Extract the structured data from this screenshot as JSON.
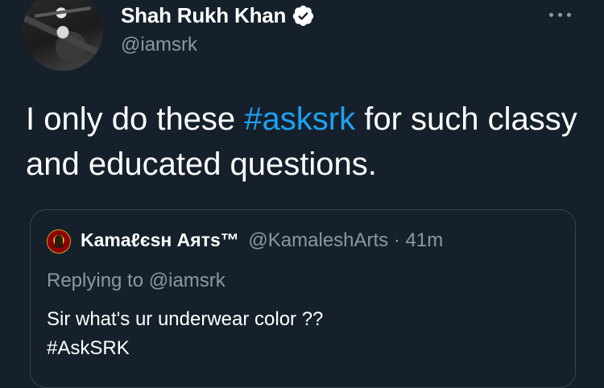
{
  "tweet": {
    "author_name": "Shah Rukh Khan",
    "author_handle": "@iamsrk",
    "text_before": "I only do these ",
    "hashtag": "#asksrk",
    "text_after": " for such classy and educated questions.",
    "verified_icon": "verified-badge-icon",
    "more_icon": "more-options-icon"
  },
  "quoted_tweet": {
    "author_name": "Kamaℓєѕн Aятѕ™",
    "author_handle": "@KamaleshArts",
    "separator": " · ",
    "time": "41m",
    "replying_label": "Replying to ",
    "replying_handle": "@iamsrk",
    "text_line1": "Sir what's ur underwear color ??",
    "text_line2": "#AskSRK"
  },
  "colors": {
    "background": "#15202b",
    "accent": "#1da1f2",
    "muted": "#8899a6",
    "border": "#38444d"
  }
}
